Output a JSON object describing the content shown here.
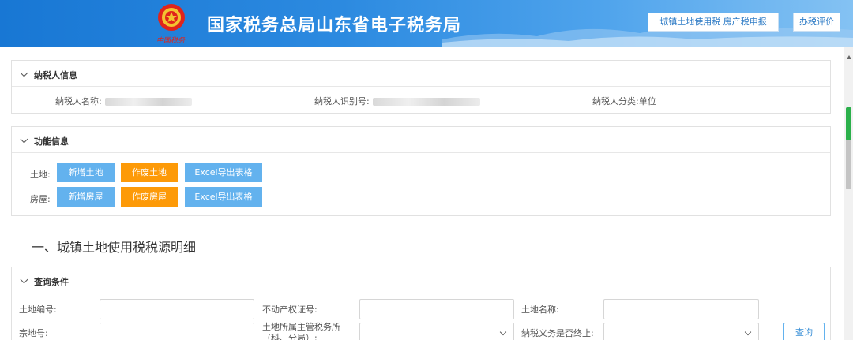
{
  "header": {
    "title": "国家税务总局山东省电子税务局",
    "emblem_caption": "中国税务",
    "buttons": [
      "城镇土地使用税 房产税申报",
      "办税评价"
    ]
  },
  "taxpayer_panel": {
    "title": "纳税人信息",
    "name_label": "纳税人名称:",
    "id_label": "纳税人识别号:",
    "category_label": "纳税人分类:",
    "category_value": "单位"
  },
  "function_panel": {
    "title": "功能信息",
    "land": {
      "label": "土地:",
      "buttons": [
        "新增土地",
        "作废土地",
        "Excel导出表格"
      ]
    },
    "house": {
      "label": "房屋:",
      "buttons": [
        "新增房屋",
        "作废房屋",
        "Excel导出表格"
      ]
    }
  },
  "section": {
    "title": "一、城镇土地使用税税源明细"
  },
  "query_panel": {
    "title": "查询条件",
    "fields": {
      "land_no": "土地编号:",
      "property_cert": "不动产权证号:",
      "land_name": "土地名称:",
      "parcel_no": "宗地号:",
      "tax_office": "土地所属主管税务所（科、分局）:",
      "obligation_ended": "纳税义务是否终止:"
    },
    "query_button": "查询"
  },
  "colors": {
    "header_blue": "#1877d4",
    "button_blue": "#63b2ee",
    "button_orange": "#fd9a08"
  }
}
